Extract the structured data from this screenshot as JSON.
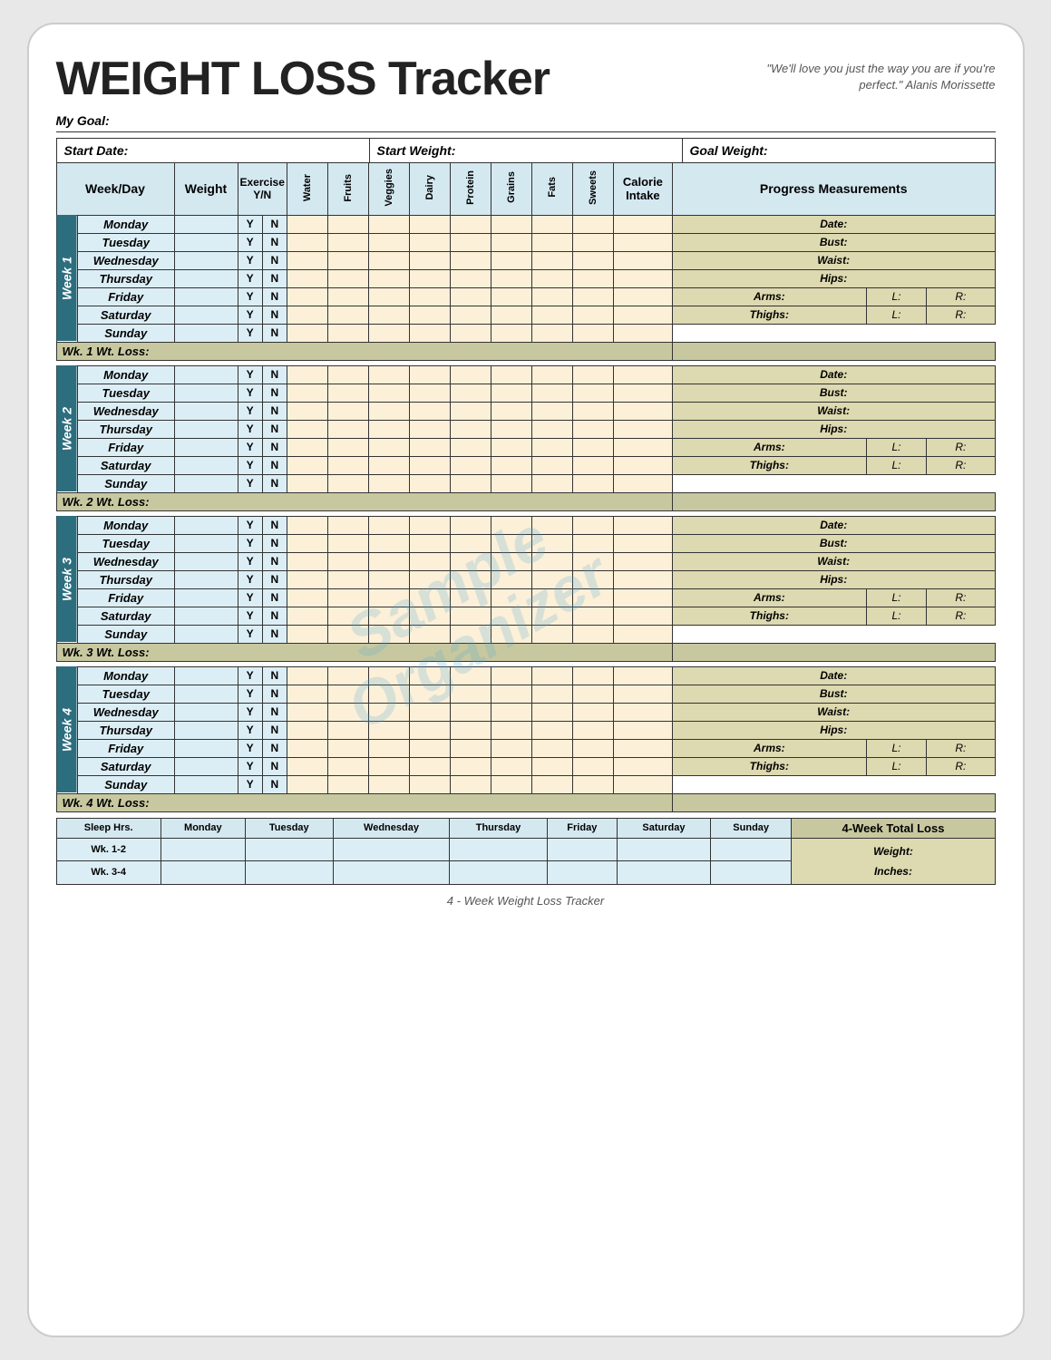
{
  "title": "WEIGHT LOSS Tracker",
  "quote": "\"We'll love you just the way you are if you're perfect.\" Alanis Morissette",
  "my_goal_label": "My Goal:",
  "start_date_label": "Start Date:",
  "start_weight_label": "Start Weight:",
  "goal_weight_label": "Goal Weight:",
  "headers": {
    "week_day": "Week/Day",
    "weight": "Weight",
    "exercise": "Exercise Y/N",
    "water": "Water",
    "fruits": "Fruits",
    "veggies": "Veggies",
    "dairy": "Dairy",
    "protein": "Protein",
    "grains": "Grains",
    "fats": "Fats",
    "sweets": "Sweets",
    "calorie": "Calorie Intake",
    "progress": "Progress Measurements"
  },
  "weeks": [
    {
      "label": "Week 1",
      "days": [
        "Monday",
        "Tuesday",
        "Wednesday",
        "Thursday",
        "Friday",
        "Saturday",
        "Sunday"
      ],
      "wt_loss": "Wk. 1 Wt. Loss:"
    },
    {
      "label": "Week 2",
      "days": [
        "Monday",
        "Tuesday",
        "Wednesday",
        "Thursday",
        "Friday",
        "Saturday",
        "Sunday"
      ],
      "wt_loss": "Wk. 2 Wt. Loss:"
    },
    {
      "label": "Week 3",
      "days": [
        "Monday",
        "Tuesday",
        "Wednesday",
        "Thursday",
        "Friday",
        "Saturday",
        "Sunday"
      ],
      "wt_loss": "Wk. 3 Wt. Loss:"
    },
    {
      "label": "Week 4",
      "days": [
        "Monday",
        "Tuesday",
        "Wednesday",
        "Thursday",
        "Friday",
        "Saturday",
        "Sunday"
      ],
      "wt_loss": "Wk. 4 Wt. Loss:"
    }
  ],
  "progress_labels": [
    "Date:",
    "Bust:",
    "Waist:",
    "Hips:",
    "Arms:",
    "Thighs:"
  ],
  "arms_lr": {
    "l": "L:",
    "r": "R:"
  },
  "thighs_lr": {
    "l": "L:",
    "r": "R:"
  },
  "bottom": {
    "sleep_hrs": "Sleep Hrs.",
    "days": [
      "Monday",
      "Tuesday",
      "Wednesday",
      "Thursday",
      "Friday",
      "Saturday",
      "Sunday"
    ],
    "rows": [
      "Wk. 1-2",
      "Wk. 3-4"
    ],
    "total_loss": "4-Week Total Loss",
    "weight_label": "Weight:",
    "inches_label": "Inches:"
  },
  "footer": "4 - Week Weight Loss Tracker",
  "watermark": "Sample\nOrganizer"
}
